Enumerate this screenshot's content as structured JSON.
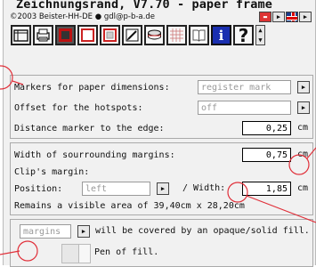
{
  "header": {
    "title": "Zeichnungsrand, V7.70 - paper frame",
    "copyright": "©2003 Beister-HH-DE ● gdl@p-b-a.de"
  },
  "toolbar": {
    "icons": [
      "frame-icon",
      "printer-icon",
      "frame-red-icon",
      "frame-red-thin-icon",
      "frame-gray-icon",
      "pencil-icon",
      "cylinder-icon",
      "grid-icon",
      "book-icon",
      "info-icon",
      "help-icon"
    ],
    "info_label": "i",
    "help_label": "?"
  },
  "rows": {
    "markers_label": "Markers for paper dimensions:",
    "markers_value": "register mark",
    "offset_label": "Offset for the hotspots:",
    "offset_value": "off",
    "distance_label": "Distance marker to the edge:",
    "distance_value": "0,25",
    "distance_unit": "cm",
    "width_label": "Width of sourrounding margins:",
    "width_value": "0,75",
    "width_unit": "cm",
    "clip_label": "Clip's margin:",
    "position_label": "Position:",
    "position_value": "left",
    "slash_width_label": "/ Width:",
    "clip_width_value": "1,85",
    "clip_width_unit": "cm",
    "remains_text": "Remains a visible area of 39,40cm x 28,20cm",
    "cover_field": "margins",
    "cover_text": "will be covered by an opaque/solid fill.",
    "pen_label": "Pen of fill."
  },
  "colors": {
    "annotation": "#e0303a",
    "accent_red": "#c8262a"
  }
}
